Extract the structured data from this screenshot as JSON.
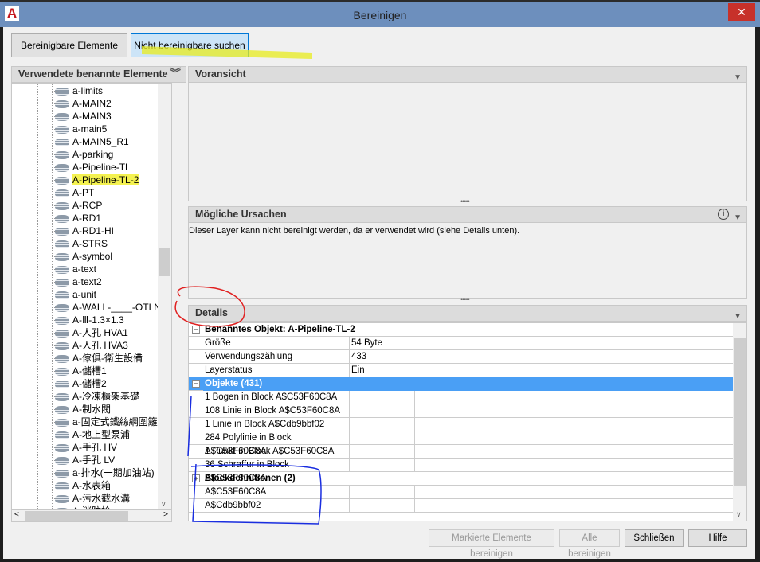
{
  "window": {
    "title": "Bereinigen",
    "close": "✕"
  },
  "toolbar": {
    "purgeable": "Bereinigbare Elemente",
    "find_nonpurgeable": "Nicht bereinigbare suchen"
  },
  "left": {
    "header": "Verwendete benannte Elemente",
    "items": [
      "a-limits",
      "A-MAIN2",
      "A-MAIN3",
      "a-main5",
      "A-MAIN5_R1",
      "A-parking",
      "A-Pipeline-TL",
      "A-Pipeline-TL-2",
      "A-PT",
      "A-RCP",
      "A-RD1",
      "A-RD1-HI",
      "A-STRS",
      "A-symbol",
      "a-text",
      "a-text2",
      "a-unit",
      "A-WALL-____-OTLN",
      "A-Ⅲ-1.3×1.3",
      "A-人孔 HVA1",
      "A-人孔 HVA3",
      "A-傢俱-衛生設備",
      "A-儲槽1",
      "A-儲槽2",
      "A-冷凍櫃架基礎",
      "A-制水閥",
      "a-固定式鐵絲網圍籬",
      "A-地上型泵浦",
      "A-手孔 HV",
      "A-手孔 LV",
      "a-排水(一期加油站)",
      "A-水表箱",
      "A-污水截水溝",
      "A-消防栓"
    ],
    "selected": "A-Pipeline-TL-2"
  },
  "preview": {
    "header": "Voransicht"
  },
  "causes": {
    "header": "Mögliche Ursachen",
    "text": "Dieser Layer kann nicht bereinigt werden, da er verwendet wird (siehe Details unten)."
  },
  "details": {
    "header": "Details",
    "object_header": "Benanntes Objekt: A-Pipeline-TL-2",
    "props": [
      {
        "k": "Größe",
        "v": "54 Byte"
      },
      {
        "k": "Verwendungszählung",
        "v": "433"
      },
      {
        "k": "Layerstatus",
        "v": "Ein"
      }
    ],
    "objects_header": "Objekte (431)",
    "objects": [
      "1 Bogen in Block A$C53F60C8A",
      "108 Linie in Block A$C53F60C8A",
      "1 Linie in Block A$Cdb9bbf02",
      "284 Polylinie in Block A$C53F60C8A",
      "1 Punkt in Block A$C53F60C8A",
      "36 Schraffur in Block A$C53F60C8A"
    ],
    "blocks_header": "Blockdefinitionen (2)",
    "blocks": [
      "A$C53F60C8A",
      "A$Cdb9bbf02"
    ]
  },
  "buttons": {
    "purge_selected": "Markierte Elemente bereinigen",
    "purge_all": "Alle bereinigen",
    "close": "Schließen",
    "help": "Hilfe"
  },
  "colors": {
    "titlebar": "#6d8fbd",
    "selection": "#4a9ff5",
    "highlighter": "#f4f250",
    "annotation_red": "#e02020",
    "annotation_blue": "#1a2ee0"
  }
}
